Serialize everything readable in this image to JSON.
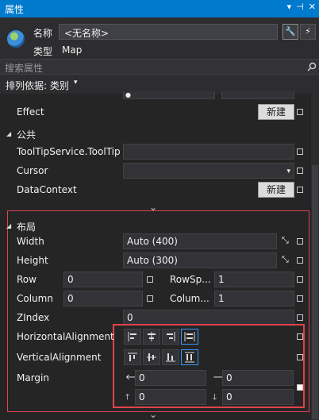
{
  "window": {
    "title": "属性"
  },
  "header": {
    "name_label": "名称",
    "name_value": "<无名称>",
    "type_label": "类型",
    "type_value": "Map"
  },
  "search": {
    "placeholder": "搜索属性"
  },
  "sort": {
    "label": "排列依据: 类别"
  },
  "effect": {
    "label": "Effect",
    "button": "新建"
  },
  "common": {
    "title": "公共",
    "tooltip_label": "ToolTipService.ToolTip",
    "cursor_label": "Cursor",
    "datacontext_label": "DataContext",
    "datacontext_button": "新建"
  },
  "layout": {
    "title": "布局",
    "width_label": "Width",
    "width_value": "Auto (400)",
    "height_label": "Height",
    "height_value": "Auto (300)",
    "row_label": "Row",
    "row_value": "0",
    "rowspan_label": "RowSp...",
    "rowspan_value": "1",
    "column_label": "Column",
    "column_value": "0",
    "columnspan_label": "Colum...",
    "columnspan_value": "1",
    "zindex_label": "ZIndex",
    "zindex_value": "0",
    "halign_label": "HorizontalAlignment",
    "valign_label": "VerticalAlignment",
    "margin_label": "Margin",
    "margin_left": "0",
    "margin_right": "0",
    "margin_top": "0",
    "margin_bottom": "0"
  }
}
